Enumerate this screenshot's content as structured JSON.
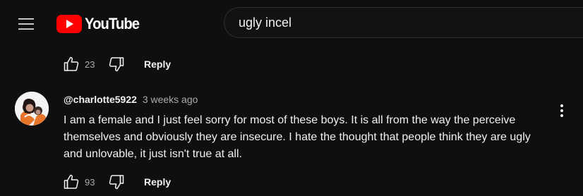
{
  "header": {
    "logo_text": "YouTube",
    "search_value": "ugly incel"
  },
  "previous_comment": {
    "like_count": "23",
    "reply_label": "Reply"
  },
  "comment": {
    "author": "@charlotte5922",
    "timestamp": "3 weeks ago",
    "text": "I am a female and I just feel sorry for most of these boys. It is all from the way the perceive themselves and obviously they are insecure. I hate the thought that people think they are ugly and unlovable, it just isn't true at all.",
    "like_count": "93",
    "reply_label": "Reply"
  },
  "colors": {
    "background": "#0f0f0f",
    "brand_red": "#ff0000",
    "text_primary": "#f1f1f1",
    "text_secondary": "#aaaaaa"
  },
  "icons": [
    "menu-icon",
    "youtube-logo-icon",
    "thumbs-up-icon",
    "thumbs-down-icon",
    "more-vert-icon"
  ]
}
